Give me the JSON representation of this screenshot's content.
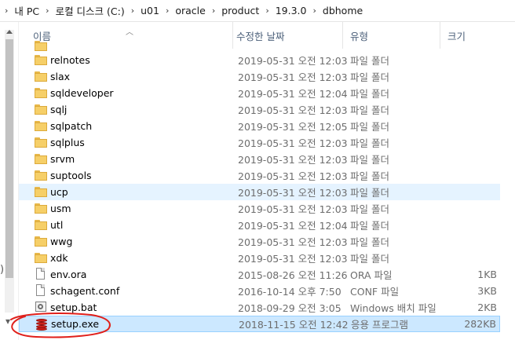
{
  "address": {
    "crumbs": [
      "내 PC",
      "로컬 디스크 (C:)",
      "u01",
      "oracle",
      "product",
      "19.3.0",
      "dbhome"
    ],
    "separator": "›"
  },
  "columns": {
    "name": "이름",
    "date": "수정한 날짜",
    "type": "유형",
    "size": "크기"
  },
  "files": [
    {
      "name": "relnotes",
      "date": "2019-05-31 오전 12:03",
      "type": "파일 폴더",
      "size": "",
      "icon": "folder-icon"
    },
    {
      "name": "slax",
      "date": "2019-05-31 오전 12:03",
      "type": "파일 폴더",
      "size": "",
      "icon": "folder-icon"
    },
    {
      "name": "sqldeveloper",
      "date": "2019-05-31 오전 12:04",
      "type": "파일 폴더",
      "size": "",
      "icon": "folder-icon"
    },
    {
      "name": "sqlj",
      "date": "2019-05-31 오전 12:03",
      "type": "파일 폴더",
      "size": "",
      "icon": "folder-icon"
    },
    {
      "name": "sqlpatch",
      "date": "2019-05-31 오전 12:05",
      "type": "파일 폴더",
      "size": "",
      "icon": "folder-icon"
    },
    {
      "name": "sqlplus",
      "date": "2019-05-31 오전 12:03",
      "type": "파일 폴더",
      "size": "",
      "icon": "folder-icon"
    },
    {
      "name": "srvm",
      "date": "2019-05-31 오전 12:03",
      "type": "파일 폴더",
      "size": "",
      "icon": "folder-icon"
    },
    {
      "name": "suptools",
      "date": "2019-05-31 오전 12:03",
      "type": "파일 폴더",
      "size": "",
      "icon": "folder-icon"
    },
    {
      "name": "ucp",
      "date": "2019-05-31 오전 12:03",
      "type": "파일 폴더",
      "size": "",
      "icon": "folder-icon"
    },
    {
      "name": "usm",
      "date": "2019-05-31 오전 12:03",
      "type": "파일 폴더",
      "size": "",
      "icon": "folder-icon"
    },
    {
      "name": "utl",
      "date": "2019-05-31 오전 12:04",
      "type": "파일 폴더",
      "size": "",
      "icon": "folder-icon"
    },
    {
      "name": "wwg",
      "date": "2019-05-31 오전 12:03",
      "type": "파일 폴더",
      "size": "",
      "icon": "folder-icon"
    },
    {
      "name": "xdk",
      "date": "2019-05-31 오전 12:03",
      "type": "파일 폴더",
      "size": "",
      "icon": "folder-icon"
    },
    {
      "name": "env.ora",
      "date": "2015-08-26 오전 11:26",
      "type": "ORA 파일",
      "size": "1KB",
      "icon": "document-icon"
    },
    {
      "name": "schagent.conf",
      "date": "2016-10-14 오후 7:50",
      "type": "CONF 파일",
      "size": "3KB",
      "icon": "document-icon"
    },
    {
      "name": "setup.bat",
      "date": "2018-09-29 오전 3:05",
      "type": "Windows 배치 파일",
      "size": "2KB",
      "icon": "batch-file-icon"
    },
    {
      "name": "setup.exe",
      "date": "2018-11-15 오전 12:42",
      "type": "응용 프로그램",
      "size": "282KB",
      "icon": "oracle-setup-icon"
    }
  ],
  "colors": {
    "hover_row": "#e5f3ff",
    "selected_row": "#cce8ff",
    "selected_border": "#99d1ff",
    "annotation": "#e0201b"
  }
}
